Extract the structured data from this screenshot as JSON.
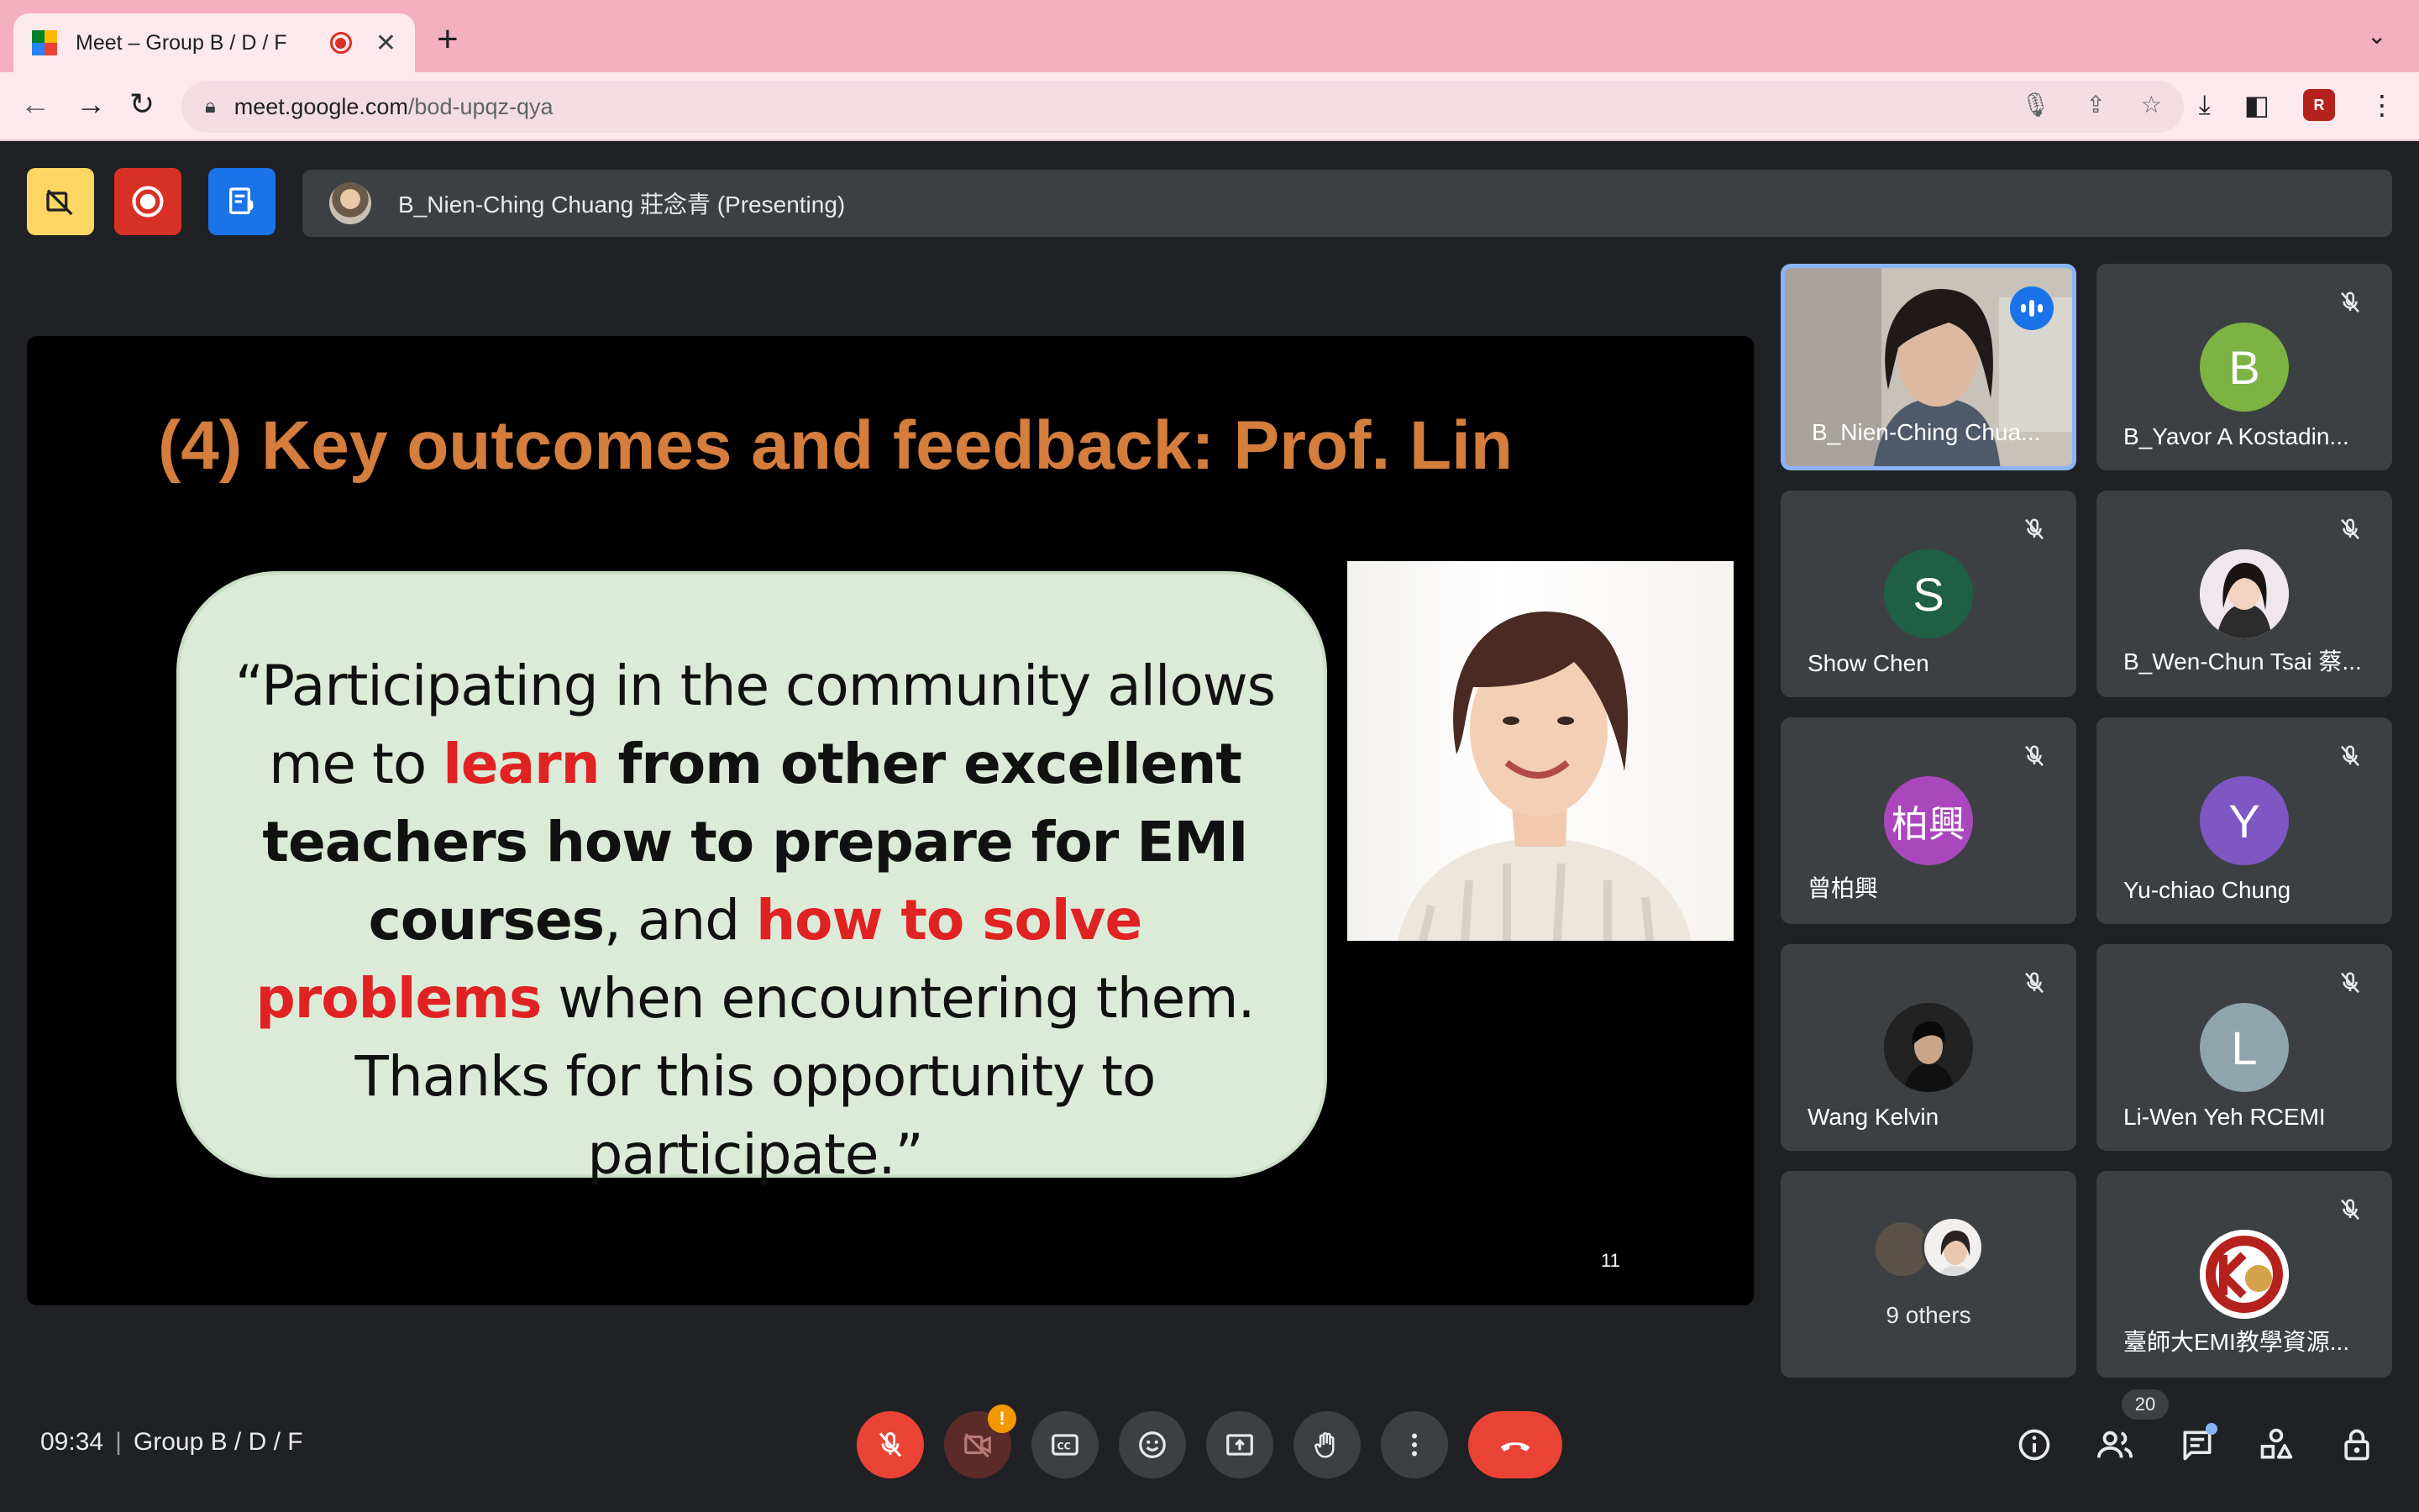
{
  "browser": {
    "tab_title": "Meet – Group B / D / F",
    "url_host": "meet.google.com",
    "url_path": "/bod-upqz-qya"
  },
  "meet": {
    "presenting_label": "B_Nien-Ching Chuang 莊念青 (Presenting)",
    "time": "09:34",
    "meeting_name": "Group B / D / F",
    "participant_count": "20"
  },
  "slide": {
    "title": "(4) Key outcomes and feedback: Prof. Lin",
    "quote": {
      "p1": "“Participating in the community allows me to ",
      "red1": "learn",
      "b1": " from other excellent teachers how to prepare for EMI courses",
      "p2": ", and ",
      "red2": "how to solve problems",
      "p3": " when encountering them. Thanks for this opportunity to participate.”"
    },
    "page_number": "11"
  },
  "participants": [
    {
      "name": "B_Nien-Ching Chua...",
      "speaking": true
    },
    {
      "name": "B_Yavor A Kostadin...",
      "initial": "B",
      "color": "#7cb342"
    },
    {
      "name": "Show Chen",
      "initial": "S",
      "color": "#1e5f46"
    },
    {
      "name": "B_Wen-Chun Tsai 蔡..."
    },
    {
      "name": "曾柏興",
      "initial": "柏興",
      "color": "#ab47bc"
    },
    {
      "name": "Yu-chiao Chung",
      "initial": "Y",
      "color": "#7e57c2"
    },
    {
      "name": "Wang Kelvin"
    },
    {
      "name": "Li-Wen Yeh RCEMI",
      "initial": "L",
      "color": "#90a4ae"
    },
    {
      "name": "9 others"
    },
    {
      "name": "臺師大EMI教學資源..."
    }
  ],
  "colors": {
    "accent_blue": "#1a73e8",
    "danger_red": "#ea4335",
    "slide_title_orange": "#d47d3d"
  }
}
